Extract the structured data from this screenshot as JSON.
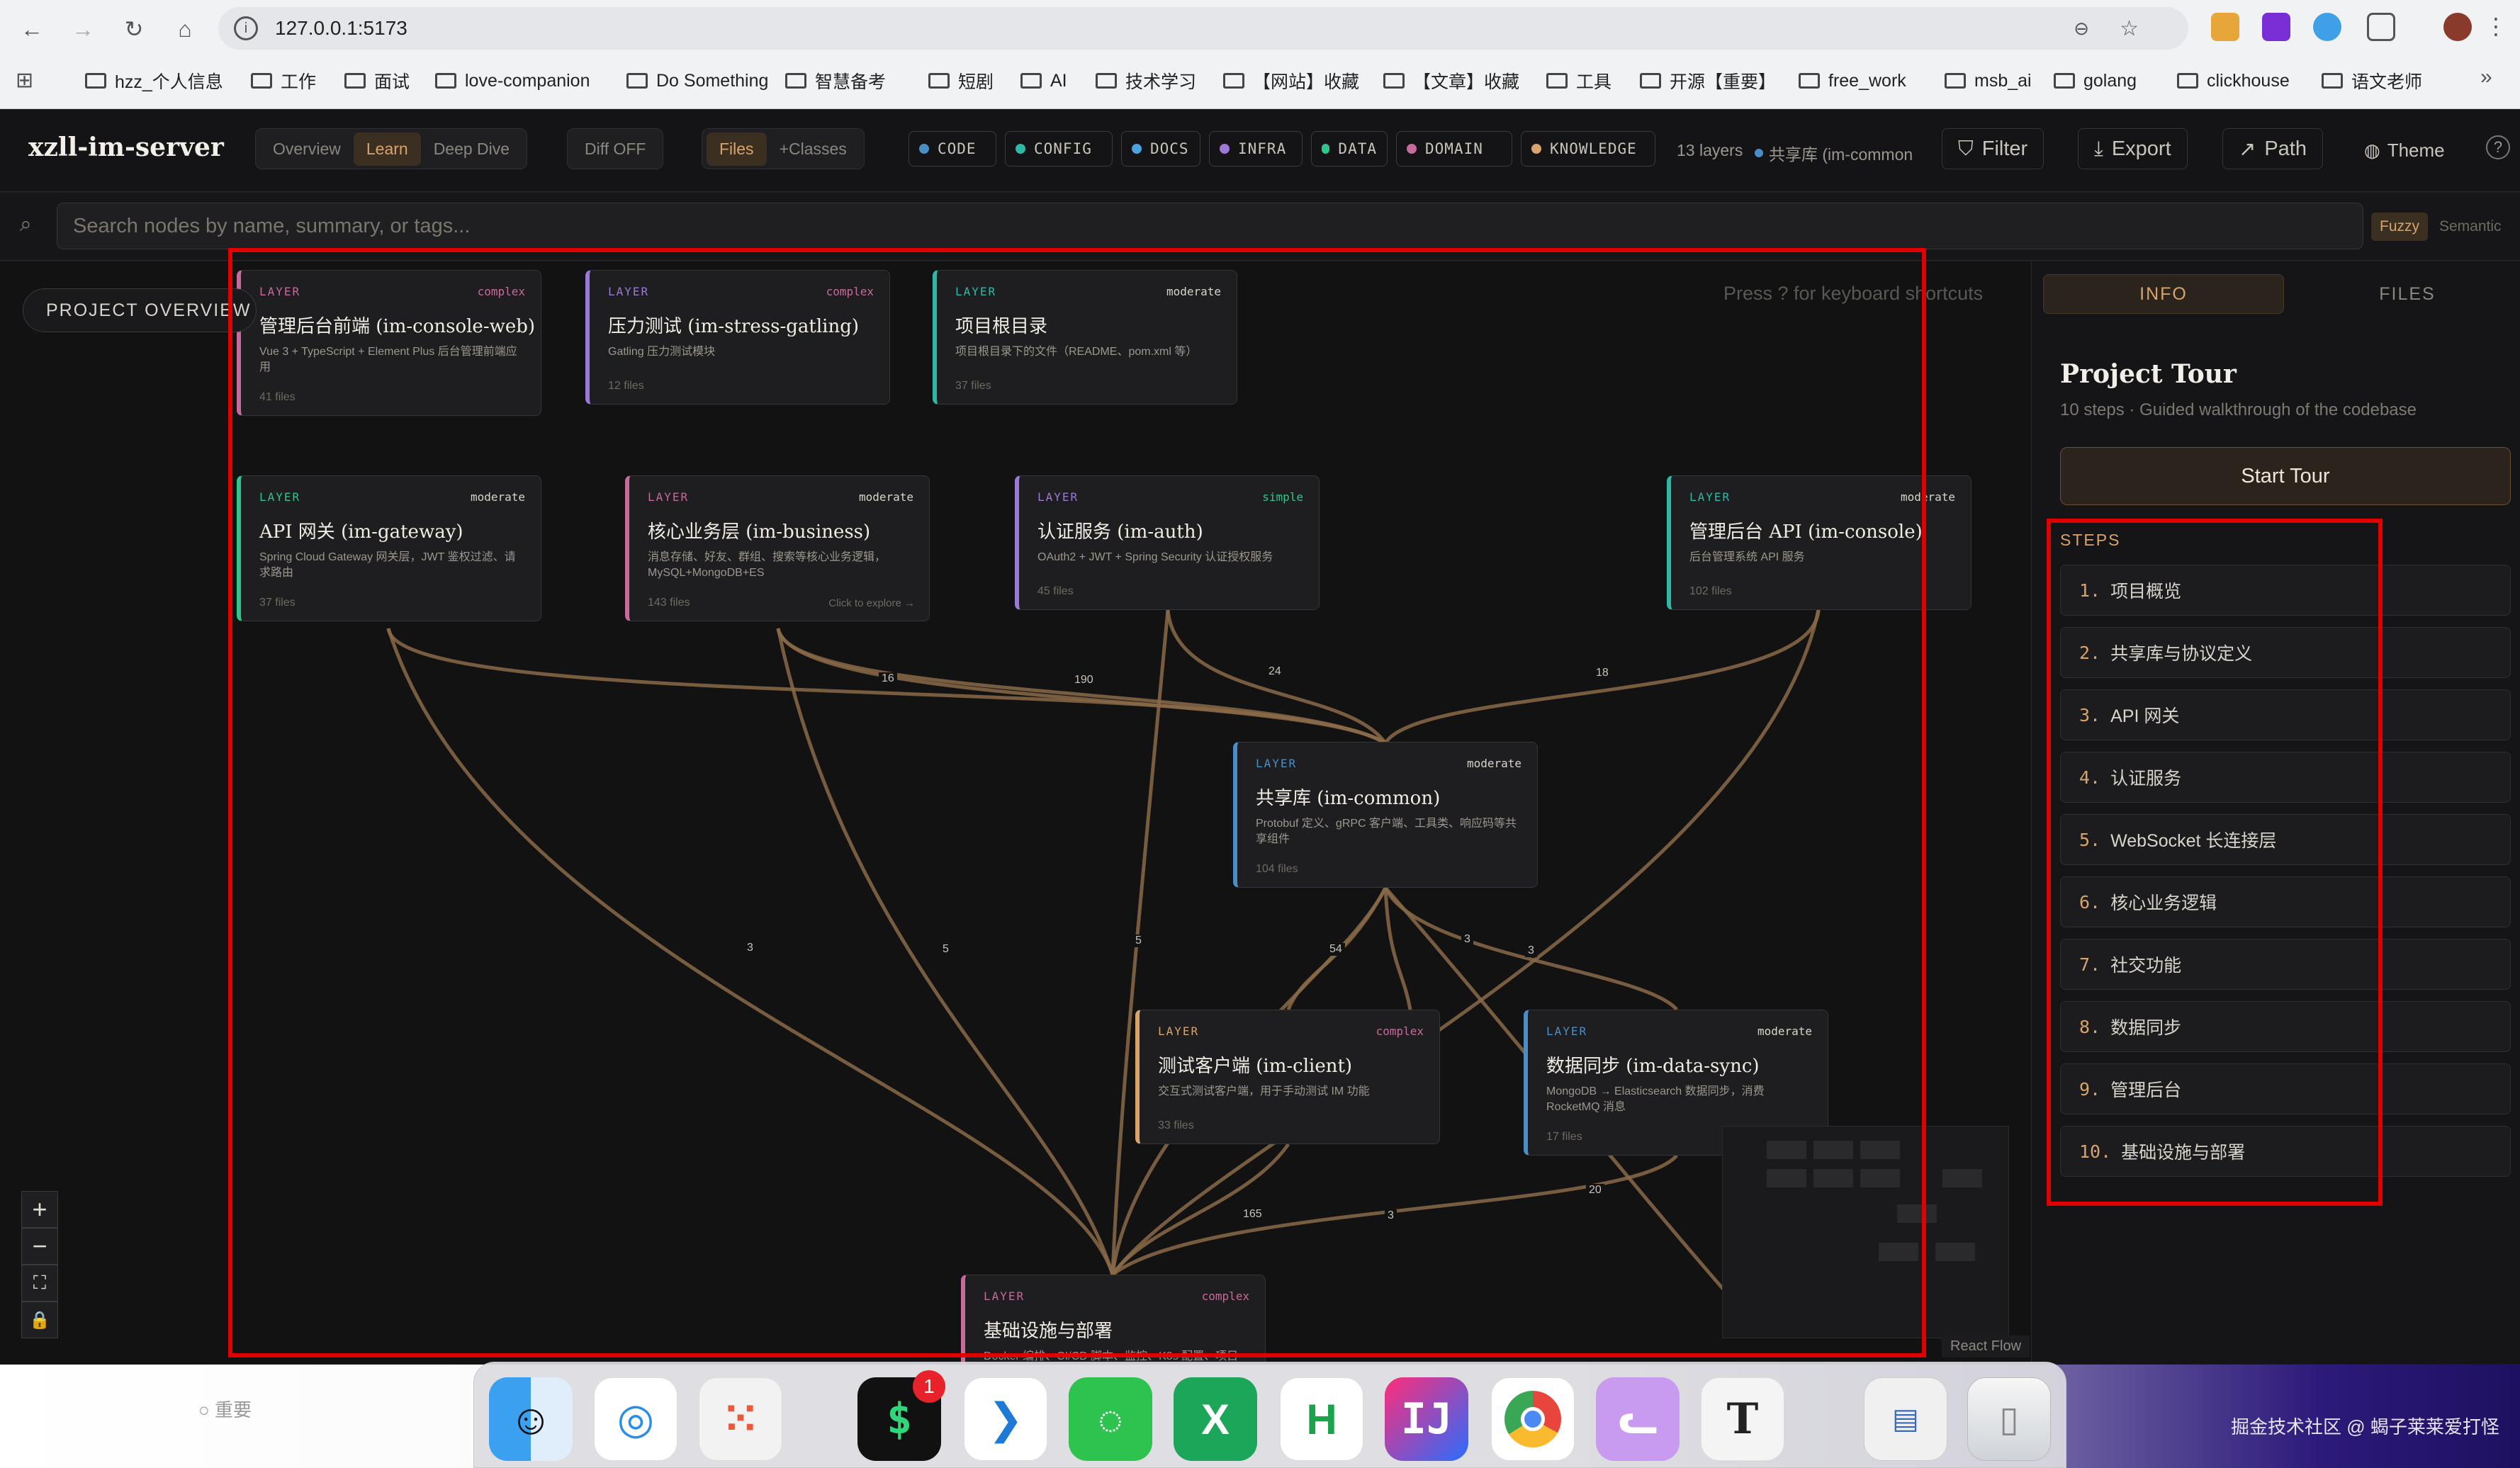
{
  "browser": {
    "url": "127.0.0.1:5173",
    "bookmarks": [
      "hzz_个人信息",
      "工作",
      "面试",
      "love-companion",
      "Do Something",
      "智慧备考",
      "短剧",
      "AI",
      "技术学习",
      "【网站】收藏",
      "【文章】收藏",
      "工具",
      "开源【重要】",
      "free_work",
      "msb_ai",
      "golang",
      "clickhouse",
      "语文老师"
    ]
  },
  "header": {
    "brand": "xzll-im-server",
    "modes": [
      "Overview",
      "Learn",
      "Deep Dive"
    ],
    "active_mode": "Learn",
    "diff": "Diff OFF",
    "view_tabs": [
      "Files",
      "+Classes"
    ],
    "tags": [
      {
        "label": "CODE",
        "color": "#4a8ec6"
      },
      {
        "label": "CONFIG",
        "color": "#2fb8a6"
      },
      {
        "label": "DOCS",
        "color": "#4aa3e0"
      },
      {
        "label": "INFRA",
        "color": "#9a7ad6"
      },
      {
        "label": "DATA",
        "color": "#2fc58c"
      },
      {
        "label": "DOMAIN",
        "color": "#c76a9c"
      },
      {
        "label": "KNOWLEDGE",
        "color": "#d9a36b"
      }
    ],
    "layers_count": "13 layers",
    "crumb": "共享库 (im-common",
    "filter": "Filter",
    "export": "Export",
    "path": "Path",
    "theme": "Theme"
  },
  "search": {
    "placeholder": "Search nodes by name, summary, or tags...",
    "fuzzy": "Fuzzy",
    "semantic": "Semantic"
  },
  "canvas": {
    "overview_button": "PROJECT OVERVIEW",
    "shortcut_hint": "Press ? for keyboard shortcuts",
    "attribution": "React Flow",
    "nodes": [
      {
        "id": "console-web",
        "label": "LAYER",
        "complexity": "complex",
        "title": "管理后台前端 (im-console-web)",
        "summary": "Vue 3 + TypeScript + Element Plus 后台管理前端应用",
        "files": "41 files"
      },
      {
        "id": "stress",
        "label": "LAYER",
        "complexity": "complex",
        "title": "压力测试 (im-stress-gatling)",
        "summary": "Gatling 压力测试模块",
        "files": "12 files"
      },
      {
        "id": "root",
        "label": "LAYER",
        "complexity": "moderate",
        "title": "项目根目录",
        "summary": "项目根目录下的文件（README、pom.xml 等）",
        "files": "37 files"
      },
      {
        "id": "gateway",
        "label": "LAYER",
        "complexity": "moderate",
        "title": "API 网关 (im-gateway)",
        "summary": "Spring Cloud Gateway 网关层，JWT 鉴权过滤、请求路由",
        "files": "37 files"
      },
      {
        "id": "business",
        "label": "LAYER",
        "complexity": "moderate",
        "title": "核心业务层 (im-business)",
        "summary": "消息存储、好友、群组、搜索等核心业务逻辑，MySQL+MongoDB+ES",
        "files": "143 files",
        "extra": "Click to explore →"
      },
      {
        "id": "auth",
        "label": "LAYER",
        "complexity": "simple",
        "title": "认证服务 (im-auth)",
        "summary": "OAuth2 + JWT + Spring Security 认证授权服务",
        "files": "45 files"
      },
      {
        "id": "console",
        "label": "LAYER",
        "complexity": "moderate",
        "title": "管理后台 API (im-console)",
        "summary": "后台管理系统 API 服务",
        "files": "102 files"
      },
      {
        "id": "common",
        "label": "LAYER",
        "complexity": "moderate",
        "title": "共享库 (im-common)",
        "summary": "Protobuf 定义、gRPC 客户端、工具类、响应码等共享组件",
        "files": "104 files"
      },
      {
        "id": "client",
        "label": "LAYER",
        "complexity": "complex",
        "title": "测试客户端 (im-client)",
        "summary": "交互式测试客户端，用于手动测试 IM 功能",
        "files": "33 files"
      },
      {
        "id": "datasync",
        "label": "LAYER",
        "complexity": "moderate",
        "title": "数据同步 (im-data-sync)",
        "summary": "MongoDB → Elasticsearch 数据同步，消费 RocketMQ 消息",
        "files": "17 files"
      },
      {
        "id": "infra",
        "label": "LAYER",
        "complexity": "complex",
        "title": "基础设施与部署",
        "summary": "Docker 编排、CI/CD 脚本、监控、K8s 配置、项目",
        "files": ""
      }
    ],
    "edge_labels": [
      "16",
      "190",
      "24",
      "18",
      "3",
      "5",
      "5",
      "54",
      "3",
      "3",
      "165",
      "3",
      "20"
    ]
  },
  "panel": {
    "tabs": [
      "INFO",
      "FILES"
    ],
    "active_tab": "INFO",
    "title": "Project Tour",
    "subtitle": "10 steps · Guided walkthrough of the codebase",
    "start": "Start Tour",
    "steps_heading": "STEPS",
    "steps": [
      {
        "num": "1.",
        "label": "项目概览"
      },
      {
        "num": "2.",
        "label": "共享库与协议定义"
      },
      {
        "num": "3.",
        "label": "API 网关"
      },
      {
        "num": "4.",
        "label": "认证服务"
      },
      {
        "num": "5.",
        "label": "WebSocket 长连接层"
      },
      {
        "num": "6.",
        "label": "核心业务逻辑"
      },
      {
        "num": "7.",
        "label": "社交功能"
      },
      {
        "num": "8.",
        "label": "数据同步"
      },
      {
        "num": "9.",
        "label": "管理后台"
      },
      {
        "num": "10.",
        "label": "基础设施与部署"
      }
    ]
  },
  "dock": {
    "badge": "1",
    "bg_note": "重要",
    "watermark": "掘金技术社区 @ 蝎子莱莱爱打怪"
  },
  "colors": {
    "accent": "#d9a36b",
    "edge": "#8a6a48",
    "annotation": "#e00000"
  }
}
